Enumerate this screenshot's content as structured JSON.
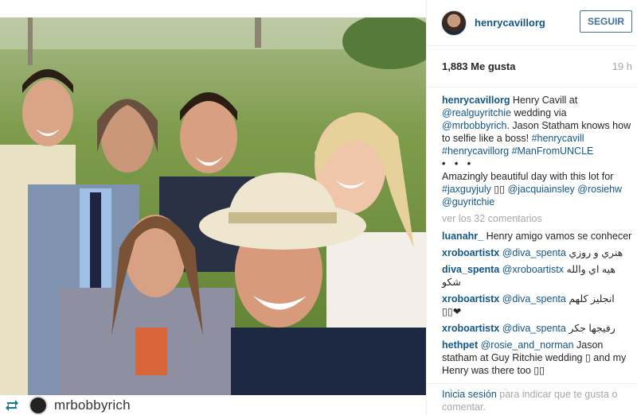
{
  "post": {
    "username": "henrycavillorg",
    "follow_label": "SEGUIR",
    "likes": "1,883 Me gusta",
    "time": "19 h"
  },
  "caption": {
    "author": "henrycavillorg",
    "t1": " Henry Cavill at ",
    "m1": "@realguyritchie",
    "t2": " wedding via ",
    "m2": "@mrbobbyrich",
    "t3": ". Jason Statham knows how to selfie like a boss! ",
    "h1": "#henrycavill",
    "h2": "#henrycavillorg",
    "h3": "#ManFromUNCLE",
    "dots": "• • •",
    "t4": "Amazingly beautiful day with this lot for ",
    "h4": "#jaxguyjuly",
    "emoji1": " ▯▯ ",
    "m3": "@jacquiainsley",
    "m4": "@rosiehw",
    "m5": "@guyritchie"
  },
  "more_comments": "ver los 32 comentarios",
  "comments": [
    {
      "user": "luanahr_",
      "text": " Henry amigo vamos se conhecer"
    },
    {
      "user": "xroboartistx",
      "mention": " @diva_spenta",
      "rtl": "هنري و روزي"
    },
    {
      "user": "diva_spenta",
      "mention": " @xroboartistx",
      "rtl": "هيه اي والله شكو"
    },
    {
      "user": "xroboartistx",
      "mention": " @diva_spenta",
      "rtl": "انجليز كلهم",
      "extra": "▯▯❤"
    },
    {
      "user": "xroboartistx",
      "mention": " @diva_spenta",
      "rtl": "رفيجها جكر"
    },
    {
      "user": "hethpet",
      "mention": " @rosie_and_norman",
      "text": " Jason statham at Guy Ritchie wedding ▯ and my Henry was there too ▯▯"
    }
  ],
  "footer": {
    "login": "Inicia sesión",
    "rest": " para indicar que te gusta o comentar."
  },
  "repost": {
    "username": "mrbobbyrich"
  },
  "colors": {
    "link": "#125688",
    "follow": "#3f729b",
    "muted": "#a5a7aa"
  }
}
